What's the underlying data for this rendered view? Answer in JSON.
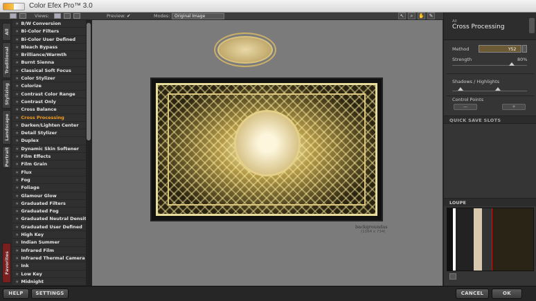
{
  "window": {
    "title": "Color Efex Pro™ 3.0"
  },
  "toolbar": {
    "views_label": "Views:",
    "preview_label": "Preview:",
    "modes_label": "Modes:",
    "modes_value": "Original Image",
    "preview_checked": "✔"
  },
  "tabs": [
    "All",
    "Traditional",
    "Stylizing",
    "Landscape",
    "Portrait",
    "Favorites"
  ],
  "filters": [
    "B/W Conversion",
    "Bi-Color Filters",
    "Bi-Color User Defined",
    "Bleach Bypass",
    "Brilliance/Warmth",
    "Burnt Sienna",
    "Classical Soft Focus",
    "Color Stylizer",
    "Colorize",
    "Contrast Color Range",
    "Contrast Only",
    "Cross Balance",
    "Cross Processing",
    "Darken/Lighten Center",
    "Detail Stylizer",
    "Duplex",
    "Dynamic Skin Softener",
    "Film Effects",
    "Film Grain",
    "Flux",
    "Fog",
    "Foliage",
    "Glamour Glow",
    "Graduated Filters",
    "Graduated Fog",
    "Graduated Neutral Density",
    "Graduated User Defined",
    "High Key",
    "Indian Summer",
    "Infrared Film",
    "Infrared Thermal Camera",
    "Ink",
    "Low Key",
    "Midnight"
  ],
  "selected_filter": "Cross Processing",
  "canvas": {
    "image_name": "backgroundas",
    "image_size": "(1164 x 734)"
  },
  "right_panel": {
    "category": "All",
    "title": "Cross Processing",
    "method_label": "Method",
    "method_value": "Y52",
    "strength_label": "Strength",
    "strength_value": "80%",
    "strength_fraction": 0.8,
    "shadows_label": "Shadows / Highlights",
    "control_points_label": "Control Points",
    "quick_save_label": "QUICK SAVE SLOTS",
    "loupe_label": "LOUPE"
  },
  "buttons": {
    "help": "HELP",
    "settings": "SETTINGS",
    "cancel": "CANCEL",
    "ok": "OK"
  },
  "colors": {
    "selected_filter": "#f39c1e",
    "favorites_tab": "#7a1e1e"
  }
}
